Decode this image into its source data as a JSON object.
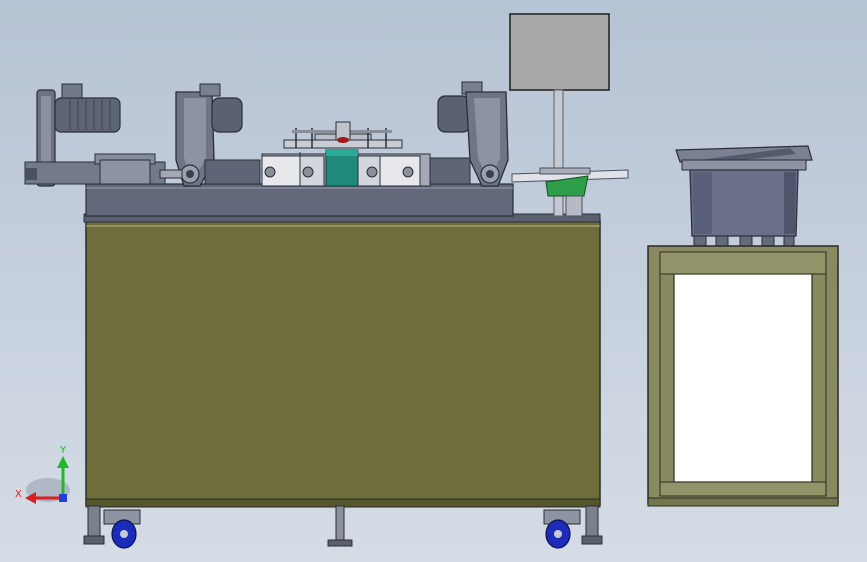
{
  "triad": {
    "y_label": "Y",
    "x_label": "X",
    "y_color": "#1fb82a",
    "x_color": "#d81e1e",
    "z_color": "#1f3fd8"
  },
  "colors": {
    "cabinet": "#6e6e3c",
    "steel": "#6e7486",
    "steel_dark": "#3c4150",
    "motor": "#606878",
    "accent_teal": "#1f8a7c",
    "accent_green": "#2e9e4a",
    "monitor": "#a9a9a9",
    "caster": "#1c2bb8",
    "frame": "#8a8a60"
  }
}
